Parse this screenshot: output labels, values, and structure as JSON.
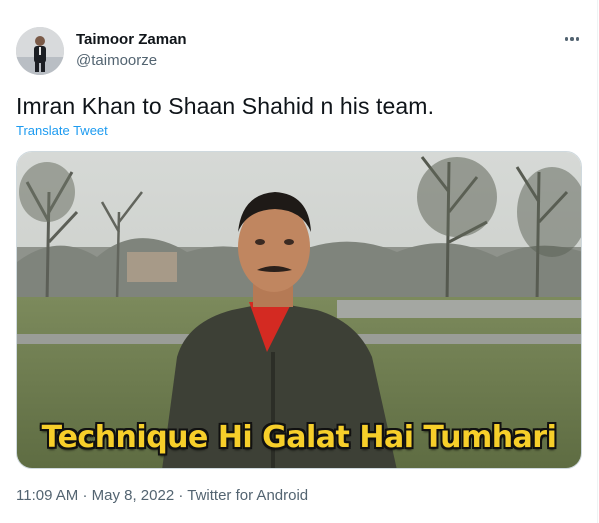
{
  "author": {
    "name": "Taimoor Zaman",
    "handle": "@taimoorze"
  },
  "tweet": {
    "text": "Imran Khan to Shaan Shahid n his team.",
    "translate_label": "Translate Tweet",
    "media_caption": "Technique Hi Galat Hai Tumhari"
  },
  "meta": {
    "time": "11:09 AM",
    "separator": "·",
    "date": "May 8, 2022",
    "source": "Twitter for Android"
  },
  "icons": {
    "more": "more-horizontal-icon"
  },
  "colors": {
    "link": "#1d9bf0",
    "secondary_text": "#536471",
    "caption": "#f7cf2a"
  }
}
